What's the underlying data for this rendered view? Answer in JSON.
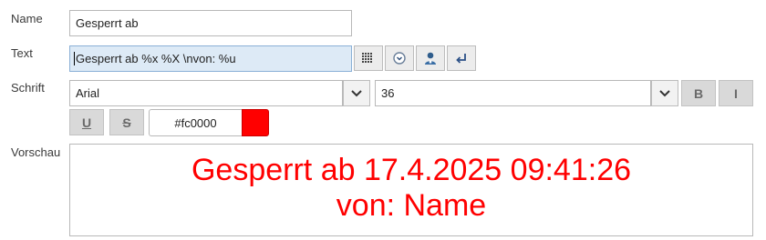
{
  "labels": {
    "name": "Name",
    "text": "Text",
    "font": "Schrift",
    "preview": "Vorschau"
  },
  "name_field": {
    "value": "Gesperrt ab"
  },
  "text_field": {
    "value": "Gesperrt ab %x %X \\nvon: %u"
  },
  "text_buttons": {
    "icons": [
      "grid-icon",
      "clock-icon",
      "user-icon",
      "newline-arrow-icon"
    ]
  },
  "font_select": {
    "value": "Arial"
  },
  "size_select": {
    "value": "36"
  },
  "style_buttons": {
    "bold": "B",
    "italic": "I",
    "underline": "U",
    "strike": "S"
  },
  "color": {
    "value": "#fc0000",
    "swatch": "#ff0000"
  },
  "preview": {
    "line1": "Gesperrt ab 17.4.2025 09:41:26",
    "line2": "von: Name",
    "text_color": "#ff0000"
  }
}
